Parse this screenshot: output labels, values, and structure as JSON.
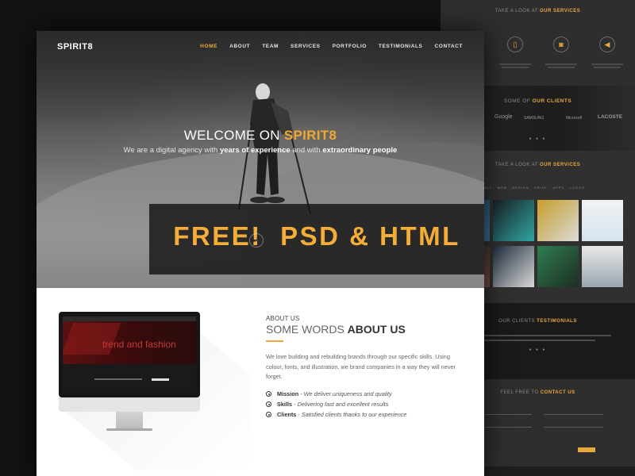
{
  "brand": "SPIRIT8",
  "nav": [
    "HOME",
    "ABOUT",
    "TEAM",
    "SERVICES",
    "PORTFOLIO",
    "TESTIMONIALS",
    "CONTACT"
  ],
  "nav_active": "HOME",
  "hero": {
    "welcome_prefix": "WELCOME ON ",
    "welcome_accent": "SPIRIT8",
    "tagline_1": "We are a digital agency with ",
    "tagline_bold_1": "years of experience",
    "tagline_2": " and with ",
    "tagline_bold_2": "extraordinary people",
    "promo": "FREE!  PSD & HTML"
  },
  "about": {
    "label": "ABOUT US",
    "title_plain": "SOME WORDS ",
    "title_bold": "ABOUT US",
    "body": "We love building and rebuilding brands through our specific skills. Using colour, fonts, and illustration, we brand companies in a way they will never forget.",
    "features": [
      {
        "name": "Mission",
        "text": "We deliver uniqueness and quality"
      },
      {
        "name": "Skills",
        "text": "Delivering fast and excellent results"
      },
      {
        "name": "Clients",
        "text": "Satisfied clients thanks to our experience"
      }
    ],
    "screen_text": "trend and fashion"
  },
  "background_page": {
    "services_heading_plain": "TAKE A LOOK AT ",
    "services_heading_bold": "OUR SERVICES",
    "clients_heading_plain": "SOME OF ",
    "clients_heading_bold": "OUR CLIENTS",
    "clients": [
      "Google",
      "SAMSUNG",
      "Microsoft",
      "LACOSTE"
    ],
    "portfolio_heading_plain": "TAKE A LOOK AT ",
    "portfolio_heading_bold": "OUR SERVICES",
    "testimonials_heading_plain": "OUR CLIENTS ",
    "testimonials_heading_bold": "TESTIMONIALS",
    "contact_heading_plain": "FEEL FREE TO ",
    "contact_heading_bold": "CONTACT US"
  },
  "colors": {
    "accent": "#f0a732",
    "dark": "#141414",
    "white": "#ffffff"
  }
}
